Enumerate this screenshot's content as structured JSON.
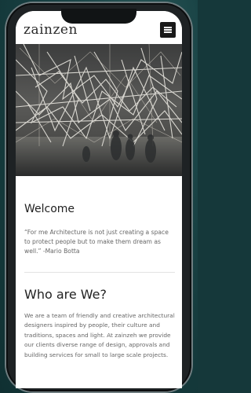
{
  "header": {
    "logo": "zainzen",
    "menu_icon": "hamburger-menu-icon"
  },
  "hero": {
    "image_description": "architectural sculpture"
  },
  "welcome": {
    "title": "Welcome",
    "quote": "“For me Architecture is not just creating a space to protect people but to make them dream as well.” -Mario Botta"
  },
  "about": {
    "title": "Who are We?",
    "text": "We are a team of friendly and creative architectural designers inspired by people, their culture and traditions, spaces and light. At zainzeh we provide our clients diverse range of design, approvals and building services for small to large scale projects."
  },
  "colors": {
    "background": "#15383a",
    "menu_button": "#1a1a1a"
  }
}
